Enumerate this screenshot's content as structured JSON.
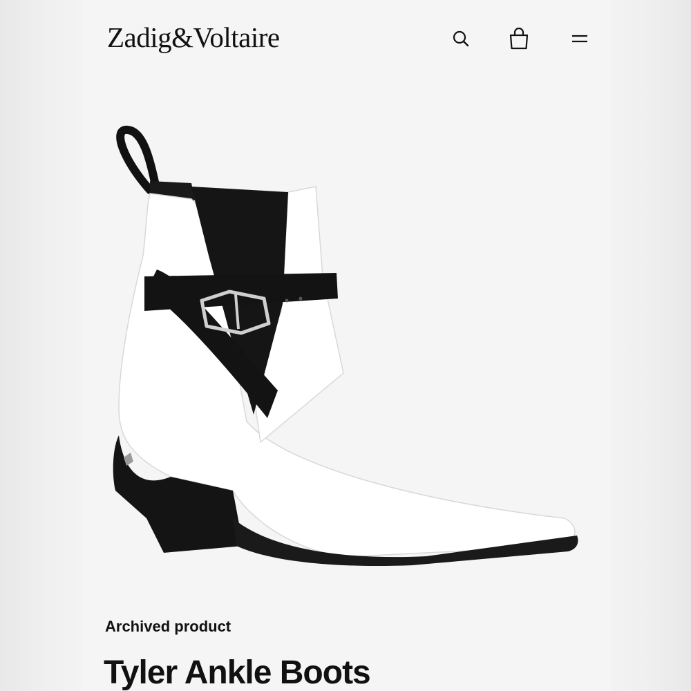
{
  "header": {
    "brand": "Zadig&Voltaire",
    "icons": {
      "search": "search-icon",
      "bag": "shopping-bag-icon",
      "menu": "hamburger-menu-icon"
    }
  },
  "product": {
    "status": "Archived product",
    "name": "Tyler Ankle Boots",
    "image": "white leather ankle boot with black strap and black heel"
  },
  "colors": {
    "background": "#f5f5f5",
    "text": "#111111",
    "boot_leather": "#ffffff",
    "strap": "#111111"
  }
}
